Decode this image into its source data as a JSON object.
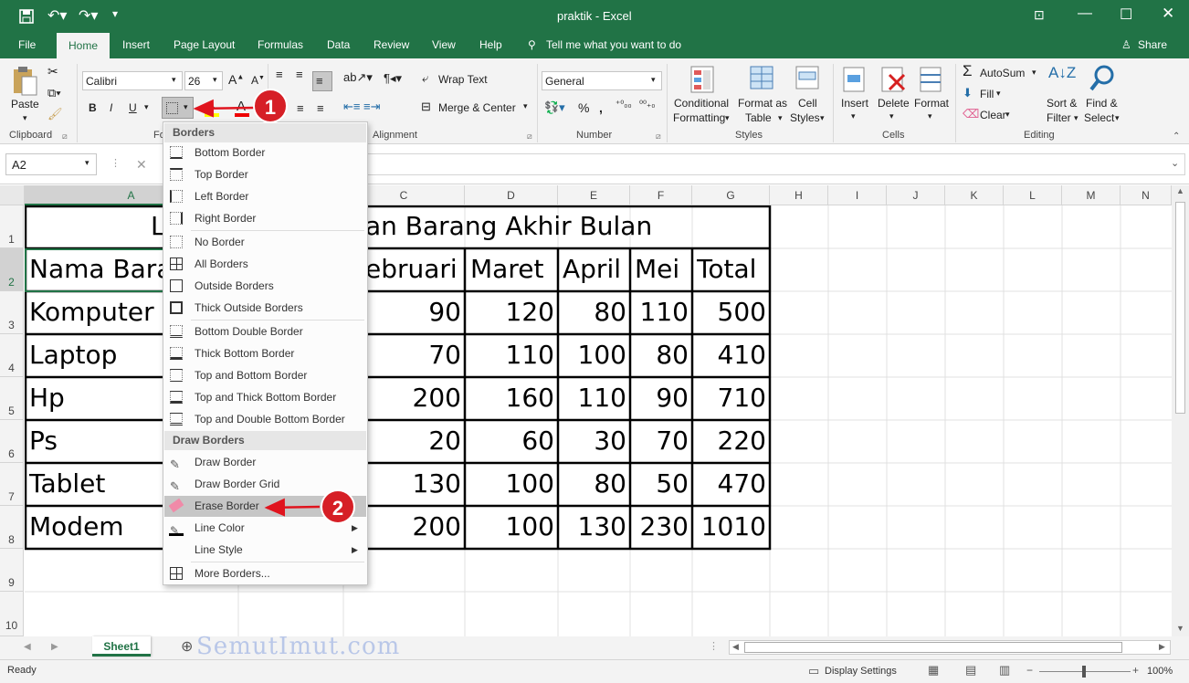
{
  "window": {
    "title": "praktik  -  Excel"
  },
  "ribbon_tabs": [
    "File",
    "Home",
    "Insert",
    "Page Layout",
    "Formulas",
    "Data",
    "Review",
    "View",
    "Help"
  ],
  "tell_me": "Tell me what you want to do",
  "share": "Share",
  "clipboard": {
    "paste": "Paste",
    "label": "Clipboard"
  },
  "font": {
    "name": "Calibri",
    "size": "26",
    "label": "Fo"
  },
  "alignment": {
    "wrap": "Wrap Text",
    "merge": "Merge & Center",
    "label": "Alignment"
  },
  "number": {
    "format": "General",
    "label": "Number"
  },
  "styles": {
    "conditional": [
      "Conditional",
      "Formatting"
    ],
    "format_table": [
      "Format as",
      "Table"
    ],
    "cell_styles": [
      "Cell",
      "Styles"
    ],
    "label": "Styles"
  },
  "cells": {
    "insert": "Insert",
    "delete": "Delete",
    "format": "Format",
    "label": "Cells"
  },
  "editing": {
    "autosum": "AutoSum",
    "fill": "Fill",
    "clear": "Clear",
    "sort": [
      "Sort &",
      "Filter"
    ],
    "find": [
      "Find &",
      "Select"
    ],
    "label": "Editing"
  },
  "name_box": "A2",
  "columns": [
    "A",
    "B",
    "C",
    "D",
    "E",
    "F",
    "G",
    "H",
    "I",
    "J",
    "K",
    "L",
    "M",
    "N"
  ],
  "rows": [
    "1",
    "2",
    "3",
    "4",
    "5",
    "6",
    "7",
    "8",
    "9",
    "10"
  ],
  "sheet": {
    "title_left": "L",
    "title_right": "an Barang Akhir Bulan",
    "header": [
      "Nama Bara",
      "ebruari",
      "Maret",
      "April",
      "Mei",
      "Total"
    ],
    "data": [
      {
        "name": "Komputer",
        "feb": "90",
        "mar": "120",
        "apr": "80",
        "mei": "110",
        "total": "500"
      },
      {
        "name": "Laptop",
        "feb": "70",
        "mar": "110",
        "apr": "100",
        "mei": "80",
        "total": "410"
      },
      {
        "name": "Hp",
        "feb": "200",
        "mar": "160",
        "apr": "110",
        "mei": "90",
        "total": "710"
      },
      {
        "name": "Ps",
        "feb": "20",
        "mar": "60",
        "apr": "30",
        "mei": "70",
        "total": "220"
      },
      {
        "name": "Tablet",
        "feb": "130",
        "mar": "100",
        "apr": "80",
        "mei": "50",
        "total": "470"
      },
      {
        "name": "Modem",
        "feb": "200",
        "mar": "100",
        "apr": "130",
        "mei": "230",
        "total": "1010"
      }
    ]
  },
  "menu": {
    "borders_header": "Borders",
    "borders": [
      "Bottom Border",
      "Top Border",
      "Left Border",
      "Right Border",
      "No Border",
      "All Borders",
      "Outside Borders",
      "Thick Outside Borders",
      "Bottom Double Border",
      "Thick Bottom Border",
      "Top and Bottom Border",
      "Top and Thick Bottom Border",
      "Top and Double Bottom Border"
    ],
    "draw_header": "Draw Borders",
    "draw": [
      "Draw Border",
      "Draw Border Grid",
      "Erase Border",
      "Line Color",
      "Line Style",
      "More Borders..."
    ]
  },
  "badges": [
    "1",
    "2"
  ],
  "sheet_tab": "Sheet1",
  "watermark": "SemutImut.com",
  "status": {
    "ready": "Ready",
    "display": "Display Settings",
    "zoom": "100%"
  },
  "colors": {
    "excel_green": "#217346",
    "badge_red": "#d61f26",
    "arrow_red": "#e0141e"
  }
}
